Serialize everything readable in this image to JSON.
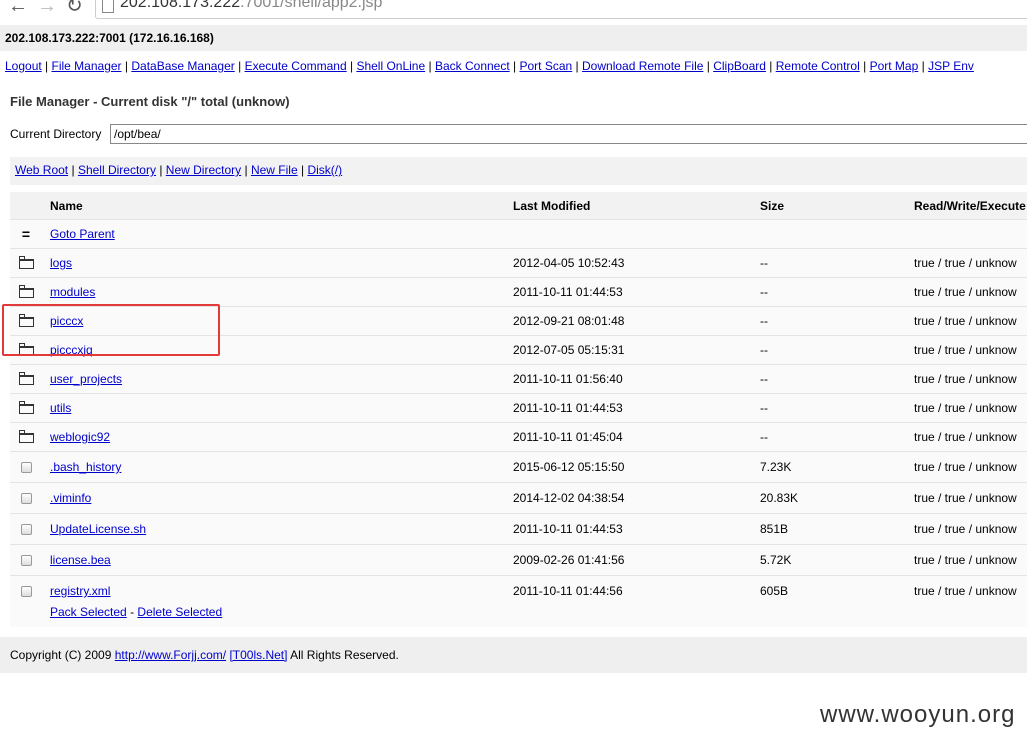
{
  "browser": {
    "url_host": "202.108.173.222",
    "url_path": ":7001/shell/app2.jsp"
  },
  "server_info": "202.108.173.222:7001 (172.16.16.168)",
  "menu": [
    "Logout",
    "File Manager",
    "DataBase Manager",
    "Execute Command",
    "Shell OnLine",
    "Back Connect",
    "Port Scan",
    "Download Remote File",
    "ClipBoard",
    "Remote Control",
    "Port Map",
    "JSP Env"
  ],
  "menu_separator": "|",
  "file_manager": {
    "title": "File Manager - Current disk \"/\" total (unknow)",
    "current_dir_label": "Current Directory",
    "current_dir_value": "/opt/bea/",
    "quick_links": [
      "Web Root",
      "Shell Directory",
      "New Directory",
      "New File",
      "Disk(/)"
    ],
    "columns": {
      "name": "Name",
      "modified": "Last Modified",
      "size": "Size",
      "rwx": "Read/Write/Execute"
    },
    "parent": {
      "icon": "=",
      "label": "Goto Parent"
    },
    "directories": [
      {
        "name": "logs",
        "modified": "2012-04-05 10:52:43",
        "size": "--",
        "rwx": "true / true / unknow"
      },
      {
        "name": "modules",
        "modified": "2011-10-11 01:44:53",
        "size": "--",
        "rwx": "true / true / unknow"
      },
      {
        "name": "picccx",
        "modified": "2012-09-21 08:01:48",
        "size": "--",
        "rwx": "true / true / unknow"
      },
      {
        "name": "picccxjq",
        "modified": "2012-07-05 05:15:31",
        "size": "--",
        "rwx": "true / true / unknow"
      },
      {
        "name": "user_projects",
        "modified": "2011-10-11 01:56:40",
        "size": "--",
        "rwx": "true / true / unknow"
      },
      {
        "name": "utils",
        "modified": "2011-10-11 01:44:53",
        "size": "--",
        "rwx": "true / true / unknow"
      },
      {
        "name": "weblogic92",
        "modified": "2011-10-11 01:45:04",
        "size": "--",
        "rwx": "true / true / unknow"
      }
    ],
    "files": [
      {
        "name": ".bash_history",
        "modified": "2015-06-12 05:15:50",
        "size": "7.23K",
        "rwx": "true / true / unknow"
      },
      {
        "name": ".viminfo",
        "modified": "2014-12-02 04:38:54",
        "size": "20.83K",
        "rwx": "true / true / unknow"
      },
      {
        "name": "UpdateLicense.sh",
        "modified": "2011-10-11 01:44:53",
        "size": "851B",
        "rwx": "true / true / unknow"
      },
      {
        "name": "license.bea",
        "modified": "2009-02-26 01:41:56",
        "size": "5.72K",
        "rwx": "true / true / unknow"
      },
      {
        "name": "registry.xml",
        "modified": "2011-10-11 01:44:56",
        "size": "605B",
        "rwx": "true / true / unknow"
      }
    ],
    "actions": {
      "pack": "Pack Selected",
      "separator": "-",
      "delete": "Delete Selected"
    }
  },
  "footer": {
    "copyright": "Copyright (C) 2009",
    "link1": "http://www.Forjj.com/",
    "link2": "[T00ls.Net]",
    "suffix": "All Rights Reserved."
  },
  "watermark": "www.wooyun.org",
  "colors": {
    "highlight": "#e23a3a",
    "link": "#0000cc"
  }
}
